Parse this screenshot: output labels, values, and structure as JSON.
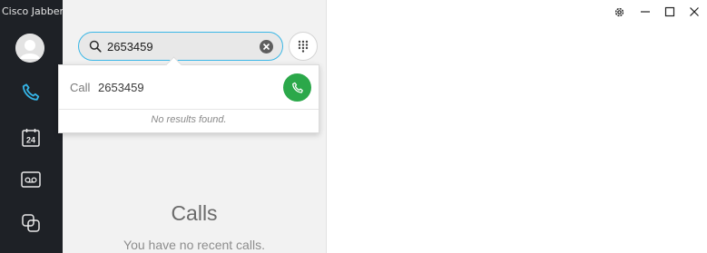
{
  "app": {
    "title": "Cisco Jabber"
  },
  "sidebar": {
    "items": [
      {
        "icon": "avatar-icon",
        "active": false
      },
      {
        "icon": "phone-icon",
        "active": true
      },
      {
        "icon": "calendar-icon",
        "label": "24",
        "active": false
      },
      {
        "icon": "voicemail-icon",
        "active": false
      },
      {
        "icon": "meetings-icon",
        "active": false
      }
    ]
  },
  "search": {
    "value": "2653459",
    "icon": "search-icon",
    "clear_icon": "clear-icon"
  },
  "dialpad": {
    "icon": "dialpad-icon"
  },
  "dropdown": {
    "call_label": "Call",
    "call_number": "2653459",
    "call_icon": "phone-icon",
    "no_results": "No results found."
  },
  "main": {
    "heading": "Calls",
    "empty_text": "You have no recent calls."
  },
  "window_controls": [
    "settings-icon",
    "minimize-icon",
    "maximize-icon",
    "close-icon"
  ],
  "colors": {
    "sidebar_bg": "#1e2126",
    "accent": "#3ab7e6",
    "call_green": "#2ba84a",
    "panel_bg": "#f2f2f2"
  }
}
